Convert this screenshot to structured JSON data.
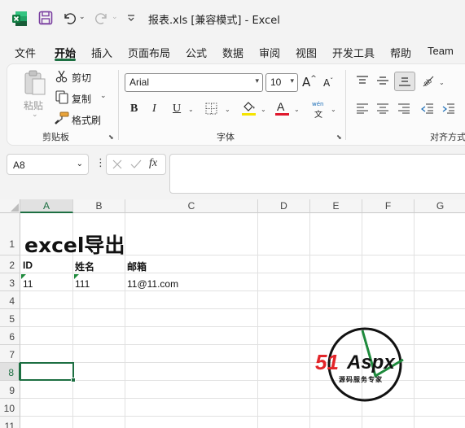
{
  "window": {
    "title": "报表.xls  [兼容模式]  -  Excel"
  },
  "ribbon_tabs": [
    "文件",
    "开始",
    "插入",
    "页面布局",
    "公式",
    "数据",
    "审阅",
    "视图",
    "开发工具",
    "帮助",
    "Team"
  ],
  "active_tab": "开始",
  "clipboard": {
    "paste_label": "粘贴",
    "cut_label": "剪切",
    "copy_label": "复制",
    "format_painter_label": "格式刷",
    "group_label": "剪贴板"
  },
  "font": {
    "name": "Arial",
    "size": "10",
    "bold": "B",
    "italic": "I",
    "underline": "U",
    "phonetic_top": "wén",
    "phonetic_bottom": "文",
    "group_label": "字体",
    "grow_label": "A",
    "shrink_label": "A",
    "font_color_label": "A",
    "highlight_color": "#f5e400",
    "font_color": "#e0182d"
  },
  "alignment": {
    "group_label": "对齐方式"
  },
  "formula_bar": {
    "name_box": "A8",
    "fx_label": "fx",
    "value": ""
  },
  "sheet": {
    "columns": [
      "A",
      "B",
      "C",
      "D",
      "E",
      "F",
      "G"
    ],
    "selected_column": "A",
    "rows": [
      "1",
      "2",
      "3",
      "4",
      "5",
      "6",
      "7",
      "8",
      "9",
      "10",
      "11"
    ],
    "selected_row": "8",
    "cells": {
      "A1": "excel导出",
      "A2": "ID",
      "B2": "姓名",
      "C2": "邮箱",
      "A3": "11",
      "B3": "111",
      "C3": "11@11.com"
    }
  },
  "watermark": {
    "brand_51": "51",
    "brand_aspx": "Aspx",
    "tagline": "源码服务专家"
  },
  "colors": {
    "excel_green": "#1d6f42",
    "save_purple": "#7a3fa0",
    "watermark_red": "#e3262a",
    "watermark_green": "#1e8a3c"
  }
}
